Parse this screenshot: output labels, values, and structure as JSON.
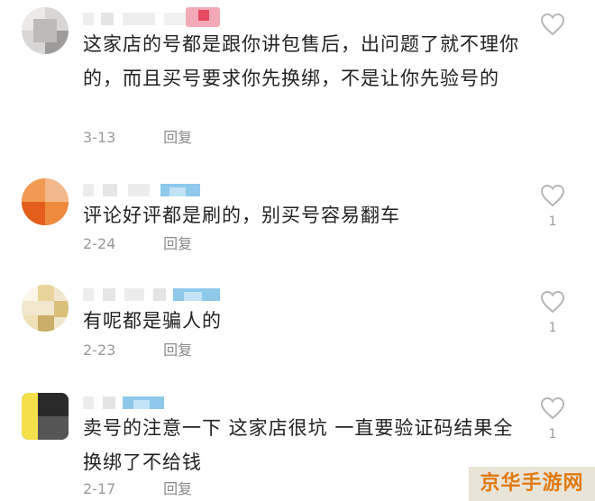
{
  "comments": [
    {
      "text": "这家店的号都是跟你讲包售后，出问题了就不理你的，而且买号要求你先换绑，不是让你先验号的",
      "date": "3-13",
      "reply_label": "回复",
      "likes": ""
    },
    {
      "text": "评论好评都是刷的，别买号容易翻车",
      "date": "2-24",
      "reply_label": "回复",
      "likes": "1"
    },
    {
      "text": "有呢都是骗人的",
      "date": "2-23",
      "reply_label": "回复",
      "likes": "1"
    },
    {
      "text": "卖号的注意一下 这家店很坑 一直要验证码结果全换绑了不给钱",
      "date": "2-17",
      "reply_label": "回复",
      "likes": "1"
    }
  ],
  "icons": {
    "like": "heart-outline-icon",
    "avatar": "pixelated-avatar"
  },
  "colors": {
    "text": "#222222",
    "meta": "#9a9a9a",
    "heart": "#b5b5b5",
    "watermark_text": "#e07a10"
  },
  "watermark": "京华手游网"
}
